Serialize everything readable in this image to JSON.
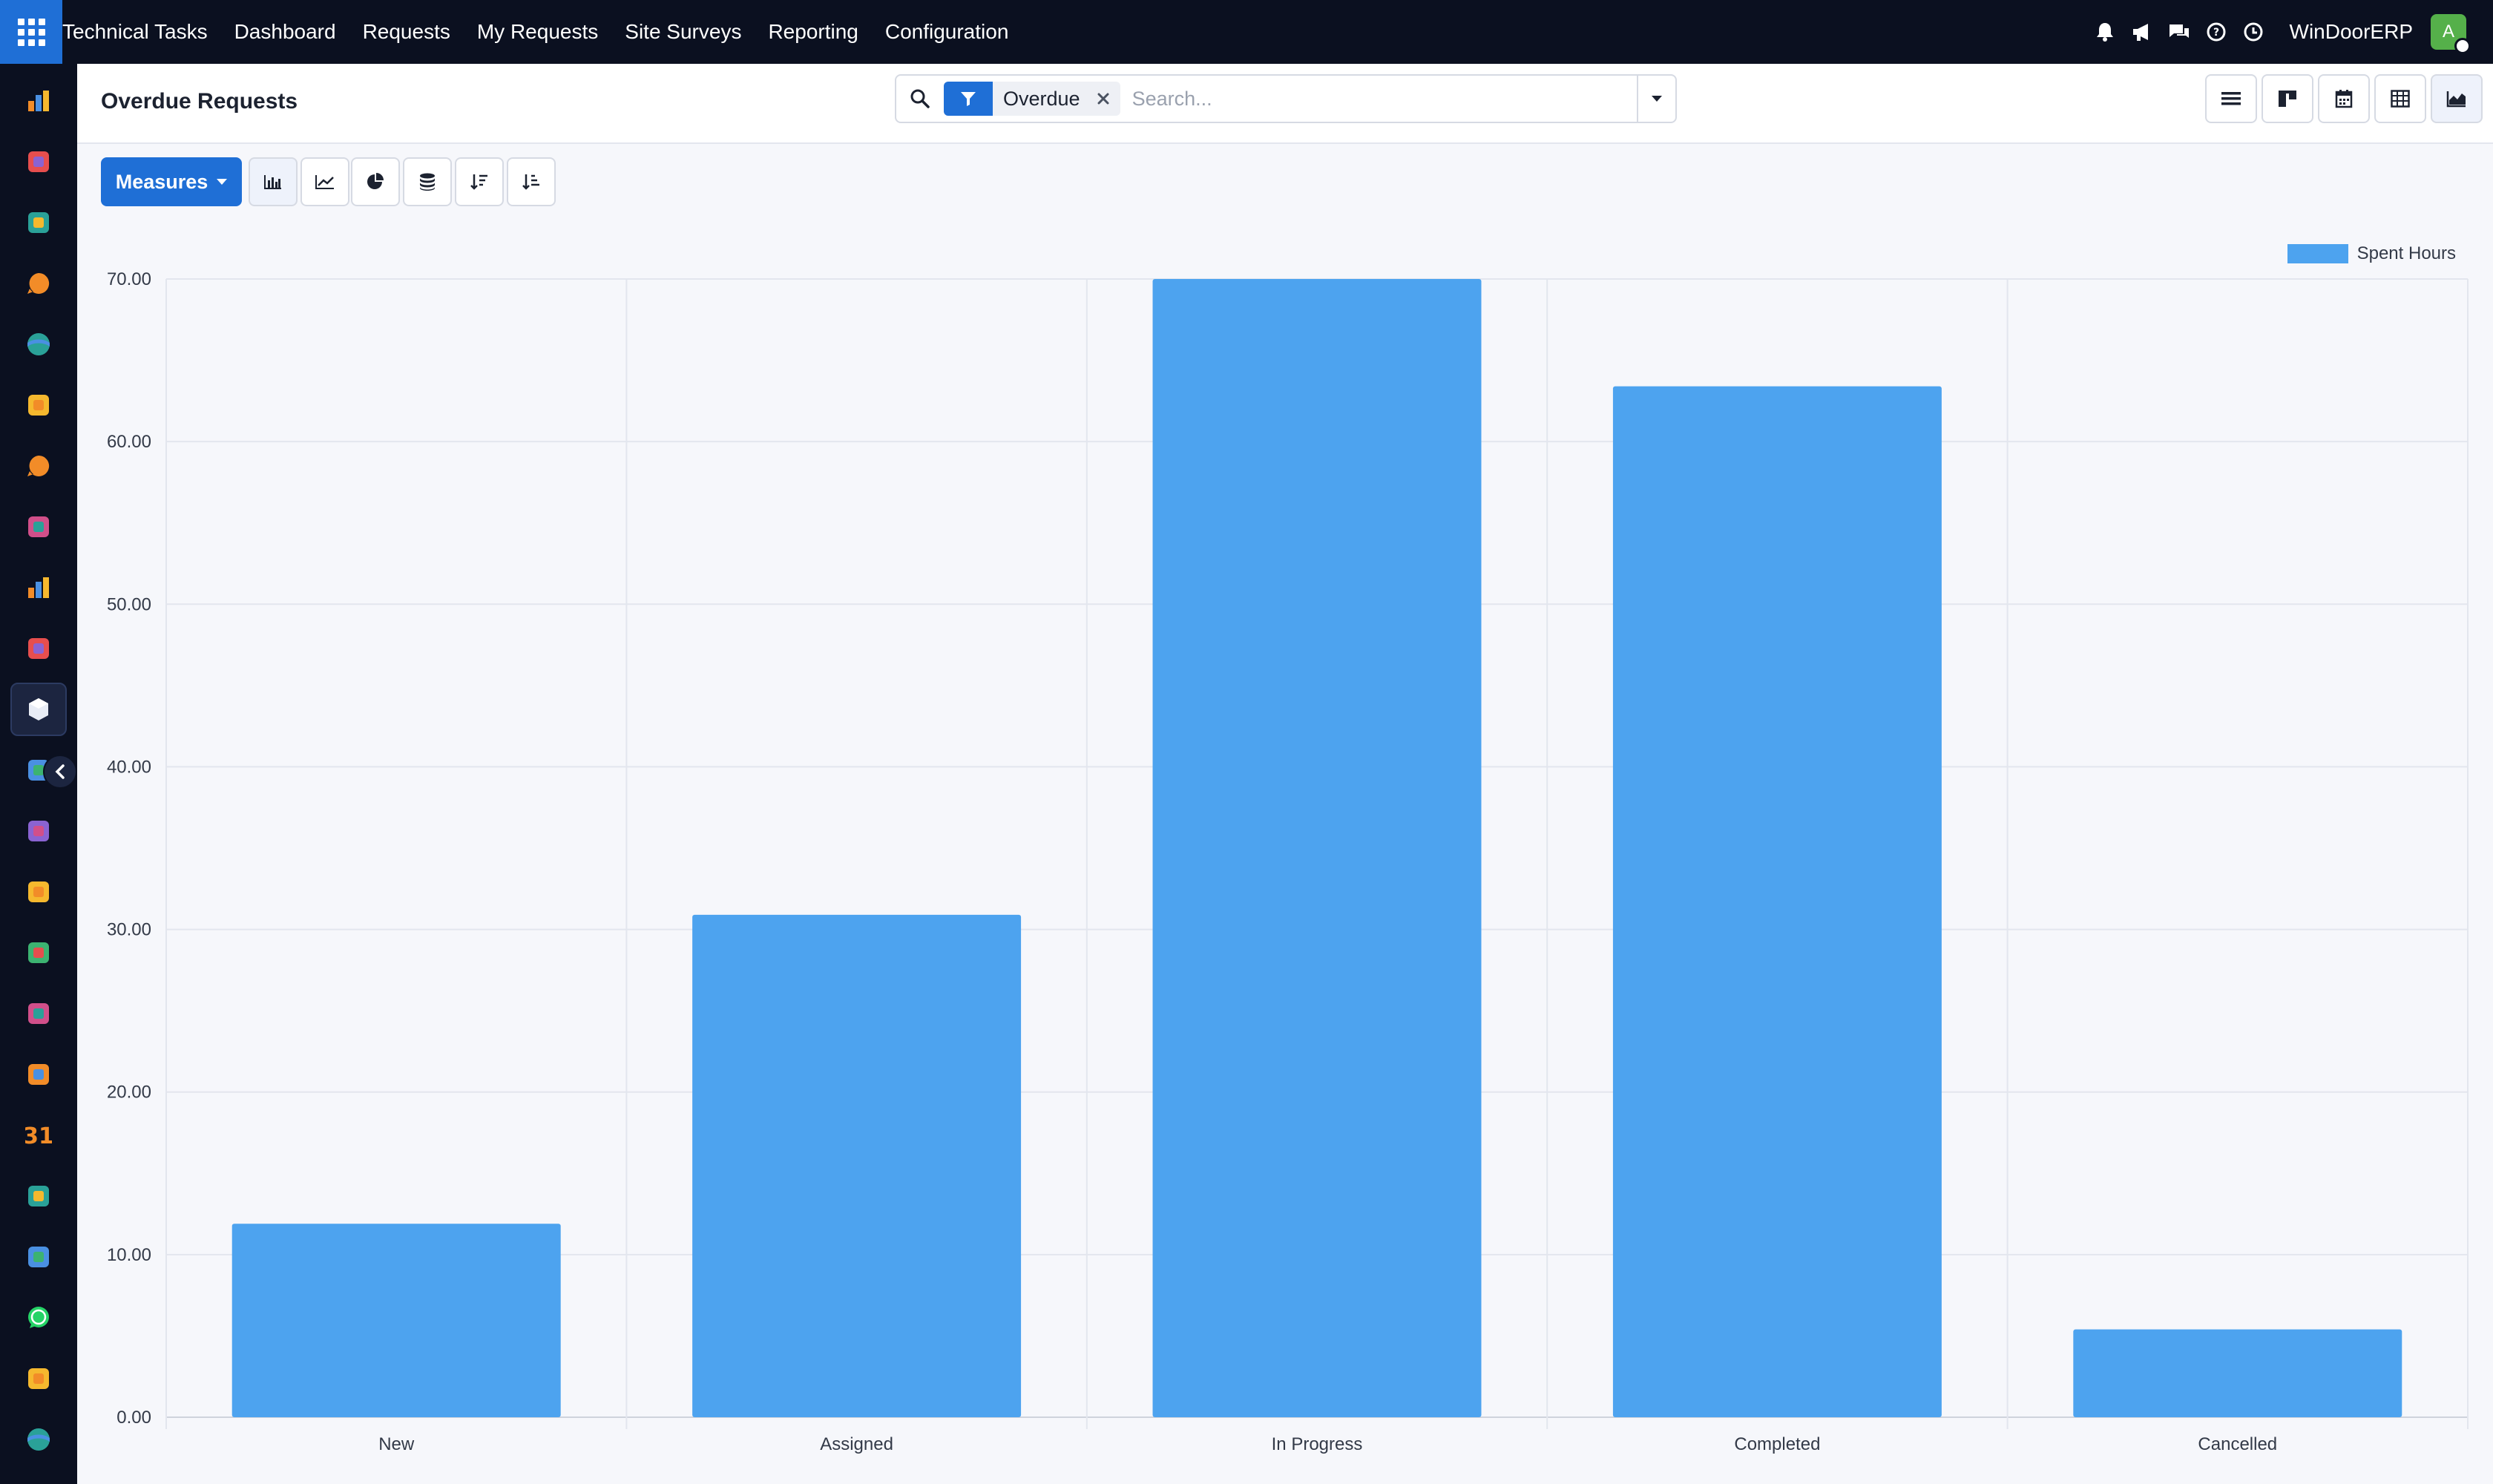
{
  "navbar": {
    "app_name": "Technical Tasks",
    "menu": [
      "Dashboard",
      "Requests",
      "My Requests",
      "Site Surveys",
      "Reporting",
      "Configuration"
    ],
    "company": "WinDoorERP",
    "avatar_letter": "A",
    "system_icons": [
      "bell-icon",
      "megaphone-icon",
      "chat-icon",
      "help-icon",
      "clock-icon"
    ]
  },
  "sidebar": {
    "apps": [
      "chart-app-icon",
      "palette-app-icon",
      "contacts-app-icon",
      "chat-bubble-app-icon",
      "globe-app-icon",
      "mail-app-icon",
      "chat-bubble-app-icon-2",
      "tag-app-icon",
      "chart-app-icon-2",
      "contacts-app-icon-2",
      "box-app-icon",
      "palette-app-icon-2",
      "check-app-icon",
      "book-app-icon",
      "cube-app-icon",
      "invoice-app-icon",
      "people-app-icon",
      "calendar-app-icon",
      "sign-app-icon",
      "dashboard-app-icon",
      "whatsapp-app-icon",
      "gauge-app-icon",
      "globe-app-icon-2"
    ],
    "active_index": 10,
    "calendar_label": "31"
  },
  "control_panel": {
    "title": "Overdue Requests",
    "facet": "Overdue",
    "search_placeholder": "Search...",
    "views": [
      "list-view-icon",
      "kanban-view-icon",
      "calendar-view-icon",
      "pivot-view-icon",
      "graph-view-icon"
    ],
    "active_view": "graph-view-icon"
  },
  "toolbar": {
    "measures_label": "Measures",
    "buttons": [
      "bar-chart-icon",
      "line-chart-icon",
      "pie-chart-icon",
      "stacked-icon",
      "sort-descending-icon",
      "sort-ascending-icon"
    ]
  },
  "colors": {
    "accent": "#1f6fd6",
    "bar": "#4da3ef",
    "nav_bg": "#0b1020"
  },
  "chart_data": {
    "type": "bar",
    "categories": [
      "New",
      "Assigned",
      "In Progress",
      "Completed",
      "Cancelled"
    ],
    "series": [
      {
        "name": "Spent Hours",
        "values": [
          11.9,
          30.9,
          70.0,
          63.4,
          5.4
        ]
      }
    ],
    "yticks": [
      "0.00",
      "10.00",
      "20.00",
      "30.00",
      "40.00",
      "50.00",
      "60.00",
      "70.00"
    ],
    "ylim": [
      0,
      70
    ],
    "grid": true,
    "legend_position": "top-right"
  }
}
